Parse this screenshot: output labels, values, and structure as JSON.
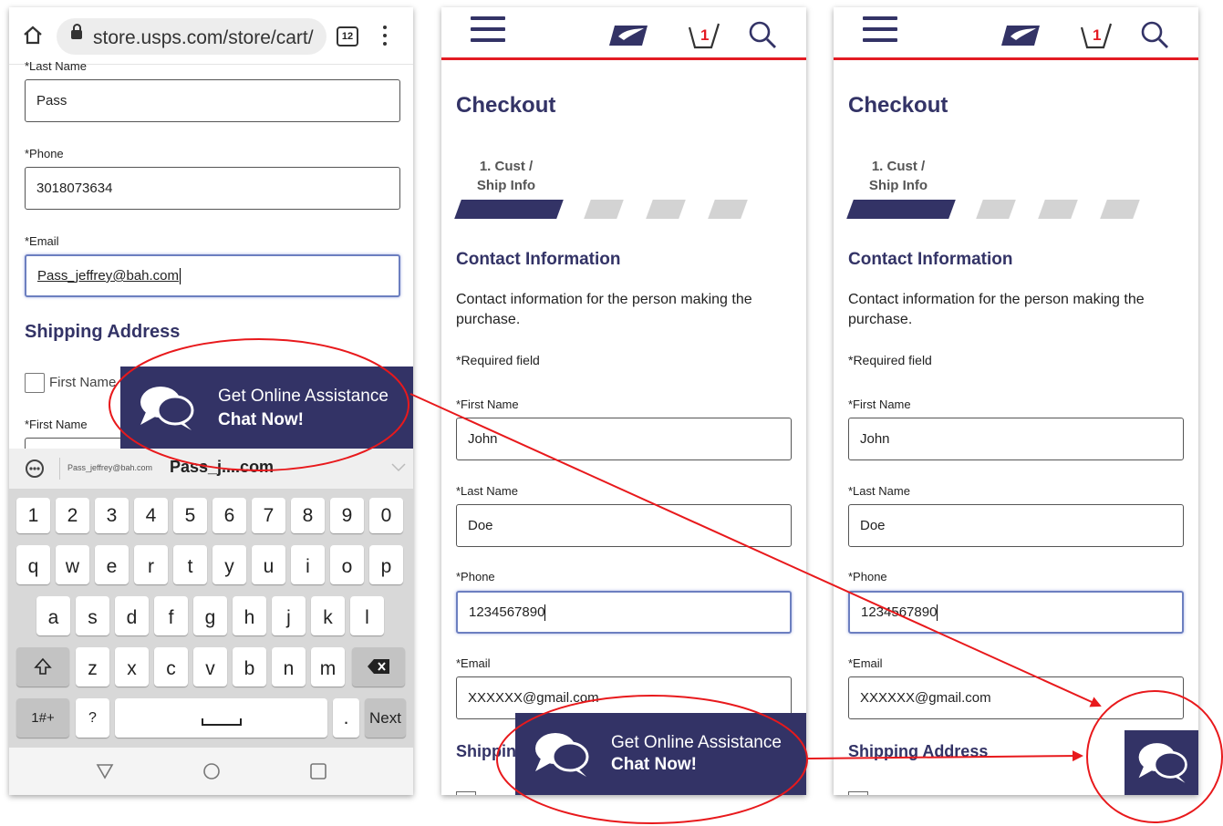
{
  "panel1": {
    "browser": {
      "url": "store.usps.com/store/cart/",
      "tab_count": "12"
    },
    "fields": [
      {
        "label": "*Last Name",
        "value": "Pass"
      },
      {
        "label": "*Phone",
        "value": "3018073634"
      },
      {
        "label": "*Email",
        "value": "Pass_jeffrey@bah.com"
      }
    ],
    "shipping_title": "Shipping Address",
    "first_name_checkbox": "First Name",
    "first_name_label": "*First Name",
    "chat": {
      "line1": "Get Online Assistance",
      "line2": "Chat Now!"
    },
    "autofill": {
      "small": "Pass_jeffrey@bah.com",
      "big": "Pass_j....com"
    },
    "keyboard": {
      "numbers": [
        "1",
        "2",
        "3",
        "4",
        "5",
        "6",
        "7",
        "8",
        "9",
        "0"
      ],
      "row1": [
        "q",
        "w",
        "e",
        "r",
        "t",
        "y",
        "u",
        "i",
        "o",
        "p"
      ],
      "row2": [
        "a",
        "s",
        "d",
        "f",
        "g",
        "h",
        "j",
        "k",
        "l"
      ],
      "row3": [
        "z",
        "x",
        "c",
        "v",
        "b",
        "n",
        "m"
      ],
      "sym": "1#+",
      "q": "?",
      "dot": ".",
      "next": "Next"
    }
  },
  "panel2": {
    "title": "Checkout",
    "step": "1. Cust / Ship Info",
    "contact_title": "Contact Information",
    "contact_desc": "Contact information for the person making the purchase.",
    "required": "*Required field",
    "fields": [
      {
        "label": "*First Name",
        "value": "John"
      },
      {
        "label": "*Last Name",
        "value": "Doe"
      },
      {
        "label": "*Phone",
        "value": "1234567890"
      },
      {
        "label": "*Email",
        "value": "XXXXXX@gmail.com"
      }
    ],
    "shipping_title": "Shipping Address",
    "chat": {
      "line1": "Get Online Assistance",
      "line2": "Chat Now!"
    }
  },
  "panel3": {
    "title": "Checkout",
    "step": "1. Cust / Ship Info",
    "contact_title": "Contact Information",
    "contact_desc": "Contact information for the person making the purchase.",
    "required": "*Required field",
    "fields": [
      {
        "label": "*First Name",
        "value": "John"
      },
      {
        "label": "*Last Name",
        "value": "Doe"
      },
      {
        "label": "*Phone",
        "value": "1234567890"
      },
      {
        "label": "*Email",
        "value": "XXXXXX@gmail.com"
      }
    ],
    "shipping_title": "Shipping Address"
  },
  "cart_count": "1",
  "colors": {
    "usps_navy": "#333366",
    "usps_red": "#e31b23",
    "annotation_red": "#e8191c"
  }
}
